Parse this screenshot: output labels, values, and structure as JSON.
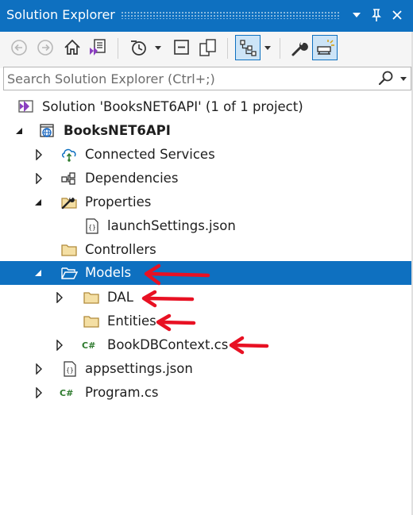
{
  "window": {
    "title": "Solution Explorer",
    "pin_glyph": "📌",
    "close_glyph": "✕",
    "dropdown_glyph": "▼"
  },
  "toolbar": {
    "buttons": [
      {
        "name": "back-button",
        "icon": "back-arrow-icon"
      },
      {
        "name": "forward-button",
        "icon": "forward-arrow-icon"
      },
      {
        "name": "home-button",
        "icon": "home-icon"
      },
      {
        "name": "switch-views-button",
        "icon": "vs-switch-view-icon"
      },
      {
        "name": "pending-changes-filter-button",
        "icon": "clock-icon"
      },
      {
        "name": "collapse-all-button",
        "icon": "collapse-icon"
      },
      {
        "name": "show-all-files-button",
        "icon": "show-all-files-icon"
      },
      {
        "name": "sync-with-active-document-button",
        "icon": "tree-sync-icon"
      },
      {
        "name": "properties-button",
        "icon": "wrench-icon"
      },
      {
        "name": "preview-selected-items-button",
        "icon": "preview-icon"
      }
    ]
  },
  "search": {
    "placeholder": "Search Solution Explorer (Ctrl+;)"
  },
  "tree": [
    {
      "label": "Solution 'BooksNET6API' (1 of 1 project)",
      "icon": "vs-solution-icon",
      "expander": "none",
      "level": 0
    },
    {
      "label": "BooksNET6API",
      "icon": "web-project-icon",
      "expander": "expanded",
      "level": 0,
      "bold": true
    },
    {
      "label": "Connected Services",
      "icon": "connected-services-icon",
      "expander": "collapsed",
      "level": 1
    },
    {
      "label": "Dependencies",
      "icon": "dependencies-icon",
      "expander": "collapsed",
      "level": 1
    },
    {
      "label": "Properties",
      "icon": "properties-folder-icon",
      "expander": "expanded",
      "level": 1
    },
    {
      "label": "launchSettings.json",
      "icon": "json-file-icon",
      "expander": "none",
      "level": 2
    },
    {
      "label": "Controllers",
      "icon": "folder-icon",
      "expander": "none",
      "level": 1
    },
    {
      "label": "Models",
      "icon": "folder-open-icon",
      "expander": "expanded",
      "level": 1,
      "selected": true
    },
    {
      "label": "DAL",
      "icon": "folder-icon",
      "expander": "collapsed",
      "level": 2
    },
    {
      "label": "Entities",
      "icon": "folder-icon",
      "expander": "none",
      "level": 2
    },
    {
      "label": "BookDBContext.cs",
      "icon": "csharp-file-icon",
      "expander": "collapsed",
      "level": 2
    },
    {
      "label": "appsettings.json",
      "icon": "json-file-icon",
      "expander": "collapsed",
      "level": 1
    },
    {
      "label": "Program.cs",
      "icon": "csharp-file-icon",
      "expander": "collapsed",
      "level": 1
    }
  ],
  "annotations": {
    "arrow_color": "#e81123"
  },
  "colors": {
    "title_bar": "#0e70c0",
    "selection": "#0e70c0"
  }
}
